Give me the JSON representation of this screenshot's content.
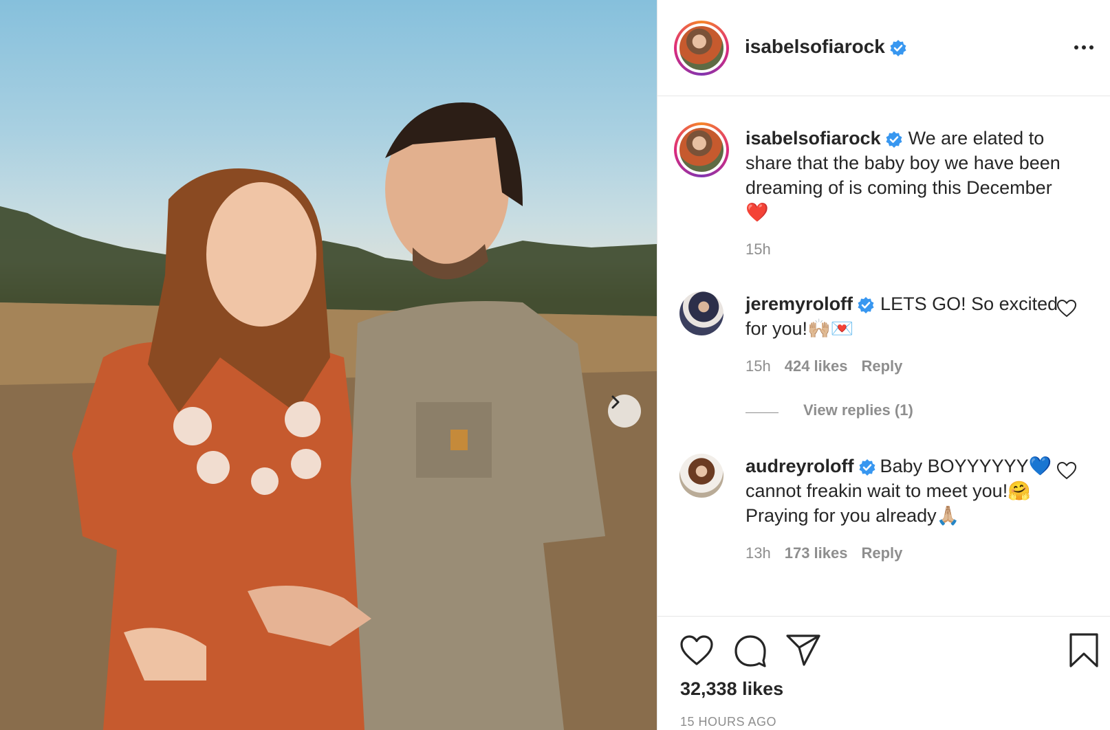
{
  "post": {
    "username": "isabelsofiarock",
    "more_icon": "more-horizontal-icon",
    "caption": "We are elated to share that the baby boy we have been dreaming of is coming this December",
    "caption_emoji": "❤️",
    "caption_time": "15h",
    "likes": "32,338 likes",
    "time_ago": "15 HOURS AGO"
  },
  "comments": [
    {
      "username": "jeremyroloff",
      "text": "LETS GO! So excited for you!🙌🏼💌",
      "time": "15h",
      "likes": "424 likes",
      "reply": "Reply",
      "view_replies": "View replies (1)"
    },
    {
      "username": "audreyroloff",
      "text": "Baby BOYYYYYY💙 cannot freakin wait to meet you!🤗 Praying for you already🙏🏼",
      "time": "13h",
      "likes": "173 likes",
      "reply": "Reply"
    }
  ],
  "colors": {
    "verified": "#3897f0",
    "text": "#262626",
    "muted": "#8e8e8e",
    "ring_start": "#f58529",
    "ring_end": "#dd2a7b"
  }
}
